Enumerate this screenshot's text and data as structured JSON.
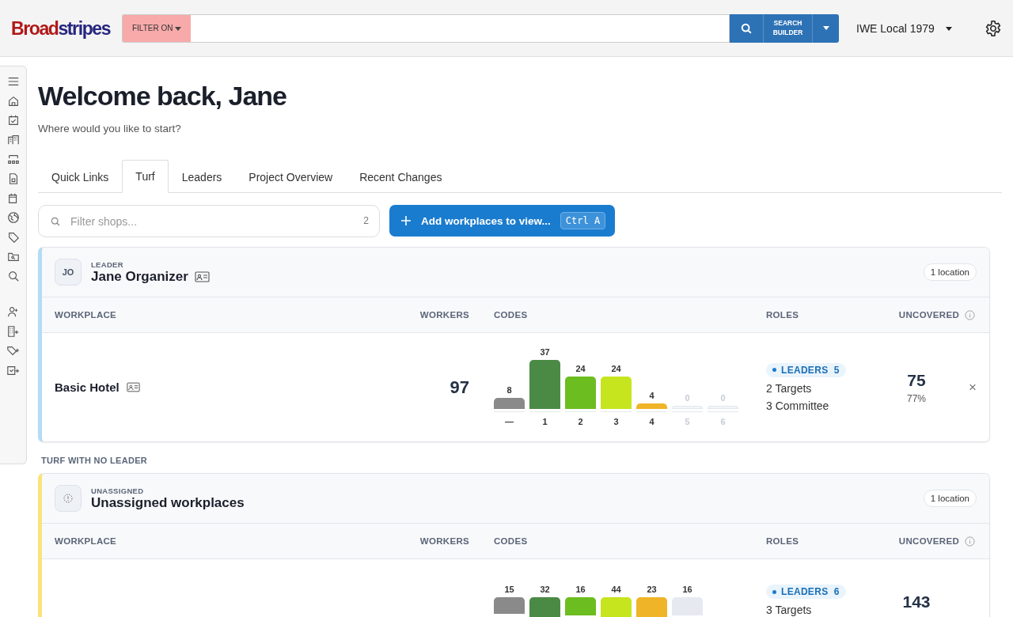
{
  "header": {
    "logo": {
      "first": "Broad",
      "second": "stripes"
    },
    "filter_button": "FILTER ON",
    "search_builder": "SEARCH BUILDER",
    "organization": "IWE Local 1979"
  },
  "greeting": {
    "title": "Welcome back, Jane",
    "subtitle": "Where would you like to start?"
  },
  "tabs": [
    {
      "label": "Quick Links",
      "selected": false
    },
    {
      "label": "Turf",
      "selected": true
    },
    {
      "label": "Leaders",
      "selected": false
    },
    {
      "label": "Project Overview",
      "selected": false
    },
    {
      "label": "Recent Changes",
      "selected": false
    }
  ],
  "filter": {
    "placeholder": "Filter shops...",
    "count": "2"
  },
  "add_button": {
    "label": "Add workplaces to view...",
    "shortcut": "Ctrl A"
  },
  "groups": [
    {
      "kind": "leader",
      "color": "#b3dcf5",
      "initials": "JO",
      "role": "LEADER",
      "name": "Jane Organizer",
      "locations": "1 location",
      "columns": [
        "WORKPLACE",
        "WORKERS",
        "CODES",
        "ROLES",
        "UNCOVERED"
      ],
      "rows": [
        {
          "workplace": "Basic Hotel",
          "workers": "97",
          "chart_data": {
            "type": "bar",
            "categories": [
              "—",
              "1",
              "2",
              "3",
              "4",
              "5",
              "6"
            ],
            "colors": [
              "#8a8a8a",
              "#4a8a45",
              "#6cbd1f",
              "#c6e51f",
              "#f0b429",
              "#e6eaf0",
              "#e6eaf0"
            ],
            "values": [
              8,
              37,
              24,
              24,
              4,
              0,
              0
            ],
            "data_labels": true
          },
          "leaders_label": "LEADERS",
          "leaders_count": "5",
          "roles": [
            "2 Targets",
            "3 Committee"
          ],
          "uncovered": "75",
          "uncovered_percent": "77%",
          "remove": "×"
        }
      ]
    },
    {
      "kind": "unassigned",
      "section_label": "TURF WITH NO LEADER",
      "color": "#fbe27a",
      "role": "UNASSIGNED",
      "name": "Unassigned workplaces",
      "locations": "1 location",
      "columns": [
        "WORKPLACE",
        "WORKERS",
        "CODES",
        "ROLES",
        "UNCOVERED"
      ],
      "rows": [
        {
          "code_counts": [
            {
              "count": "15",
              "color": "#8a8a8a"
            },
            {
              "count": "32",
              "color": "#4a8a45"
            },
            {
              "count": "16",
              "color": "#6cbd1f"
            },
            {
              "count": "44",
              "color": "#c6e51f"
            },
            {
              "count": "23",
              "color": "#f0b429"
            },
            {
              "count": "16",
              "color": "#e6eaf0"
            }
          ],
          "leaders_label": "LEADERS",
          "leaders_count": "6",
          "roles": [
            "3 Targets"
          ],
          "uncovered": "143"
        }
      ]
    }
  ]
}
